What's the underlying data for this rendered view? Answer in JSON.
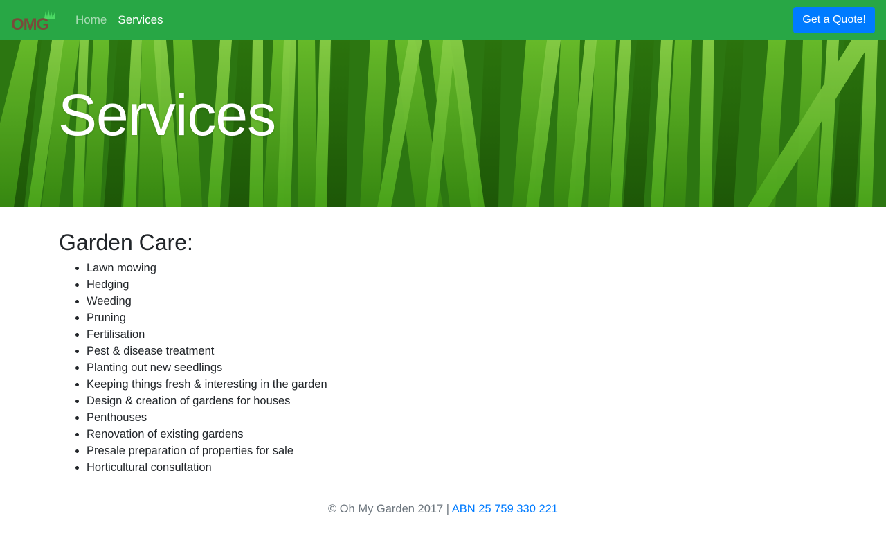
{
  "brand": {
    "logo_text": "OMG",
    "colors": {
      "text": "#7a4a3a",
      "grass": "#4cd964"
    }
  },
  "nav": {
    "items": [
      {
        "label": "Home",
        "active": false
      },
      {
        "label": "Services",
        "active": true
      }
    ],
    "cta_label": "Get a Quote!"
  },
  "hero": {
    "title": "Services"
  },
  "services": {
    "heading": "Garden Care:",
    "items": [
      "Lawn mowing",
      "Hedging",
      "Weeding",
      "Pruning",
      "Fertilisation",
      "Pest & disease treatment",
      "Planting out new seedlings",
      "Keeping things fresh & interesting in the garden",
      "Design & creation of gardens for houses",
      "Penthouses",
      "Renovation of existing gardens",
      "Presale preparation of properties for sale",
      "Horticultural consultation"
    ]
  },
  "footer": {
    "copyright": "© Oh My Garden 2017 | ",
    "abn_link": "ABN 25 759 330 221"
  },
  "colors": {
    "navbar": "#28a745",
    "button": "#007bff",
    "link": "#007bff",
    "muted": "#6c757d"
  }
}
